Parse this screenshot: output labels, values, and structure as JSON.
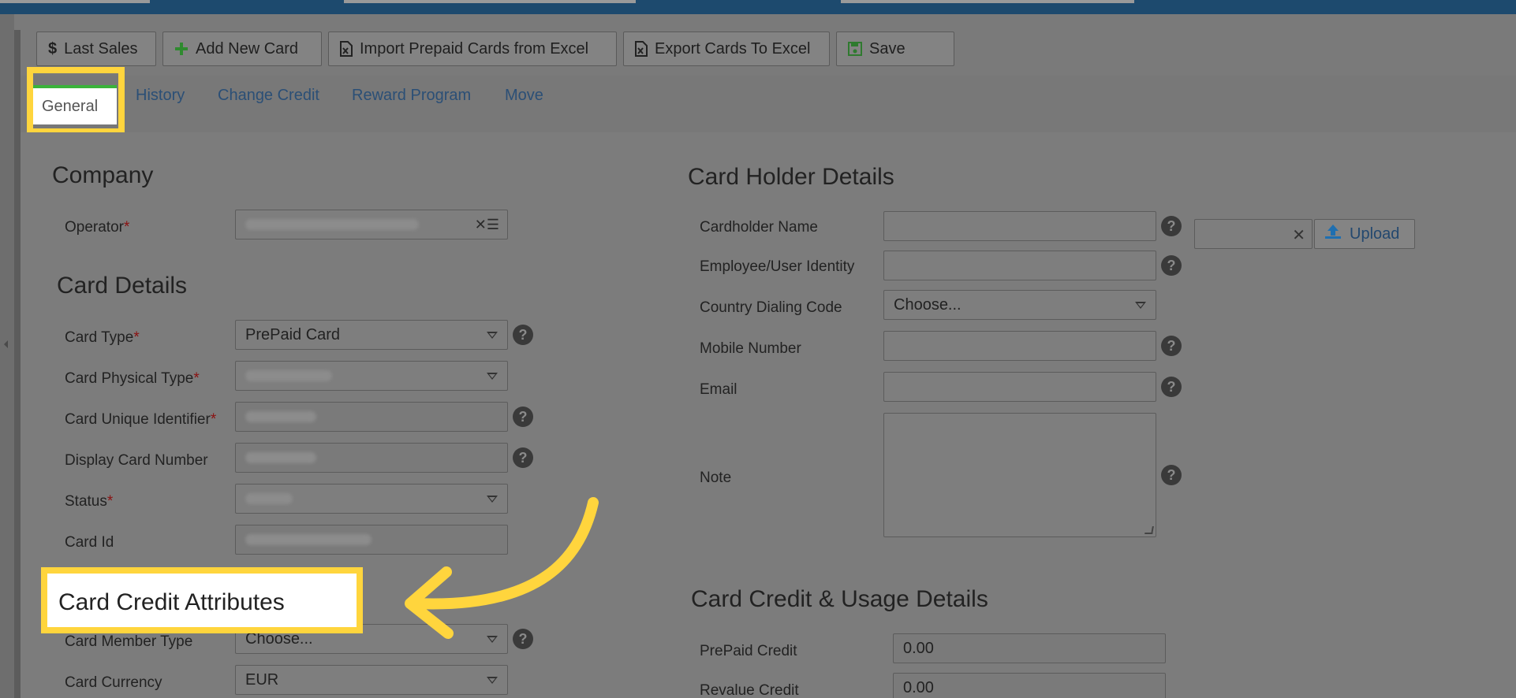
{
  "colors": {
    "topbar": "#1d4a6e",
    "highlight": "#ffd53d",
    "active_tab_accent": "#3bb33b",
    "link": "#2b4f76",
    "required": "#8b1111"
  },
  "toolbar": {
    "last_sales": "Last Sales",
    "add_new_card": "Add New Card",
    "import_prepaid": "Import Prepaid Cards from Excel",
    "export_cards": "Export Cards To Excel",
    "save": "Save"
  },
  "tabs": {
    "general": "General",
    "history": "History",
    "change_credit": "Change Credit",
    "reward_program": "Reward Program",
    "move": "Move"
  },
  "company": {
    "title": "Company",
    "operator_label": "Operator"
  },
  "card_details": {
    "title": "Card Details",
    "card_type_label": "Card Type",
    "card_type_value": "PrePaid Card",
    "physical_type_label": "Card Physical Type",
    "unique_id_label": "Card Unique Identifier",
    "display_number_label": "Display Card Number",
    "status_label": "Status",
    "card_id_label": "Card Id"
  },
  "card_credit_attributes": {
    "title": "Card Credit Attributes",
    "member_type_label": "Card Member Type",
    "member_type_value": "Choose...",
    "currency_label": "Card Currency",
    "currency_value": "EUR"
  },
  "card_holder": {
    "title": "Card Holder Details",
    "name_label": "Cardholder Name",
    "employee_label": "Employee/User Identity",
    "country_code_label": "Country Dialing Code",
    "country_code_value": "Choose...",
    "mobile_label": "Mobile Number",
    "email_label": "Email",
    "note_label": "Note",
    "upload_label": "Upload"
  },
  "usage": {
    "title": "Card Credit & Usage Details",
    "prepaid_label": "PrePaid Credit",
    "prepaid_value": "0.00",
    "revalue_label": "Revalue Credit",
    "revalue_value": "0.00"
  },
  "required_mark": "*",
  "help_glyph": "?"
}
